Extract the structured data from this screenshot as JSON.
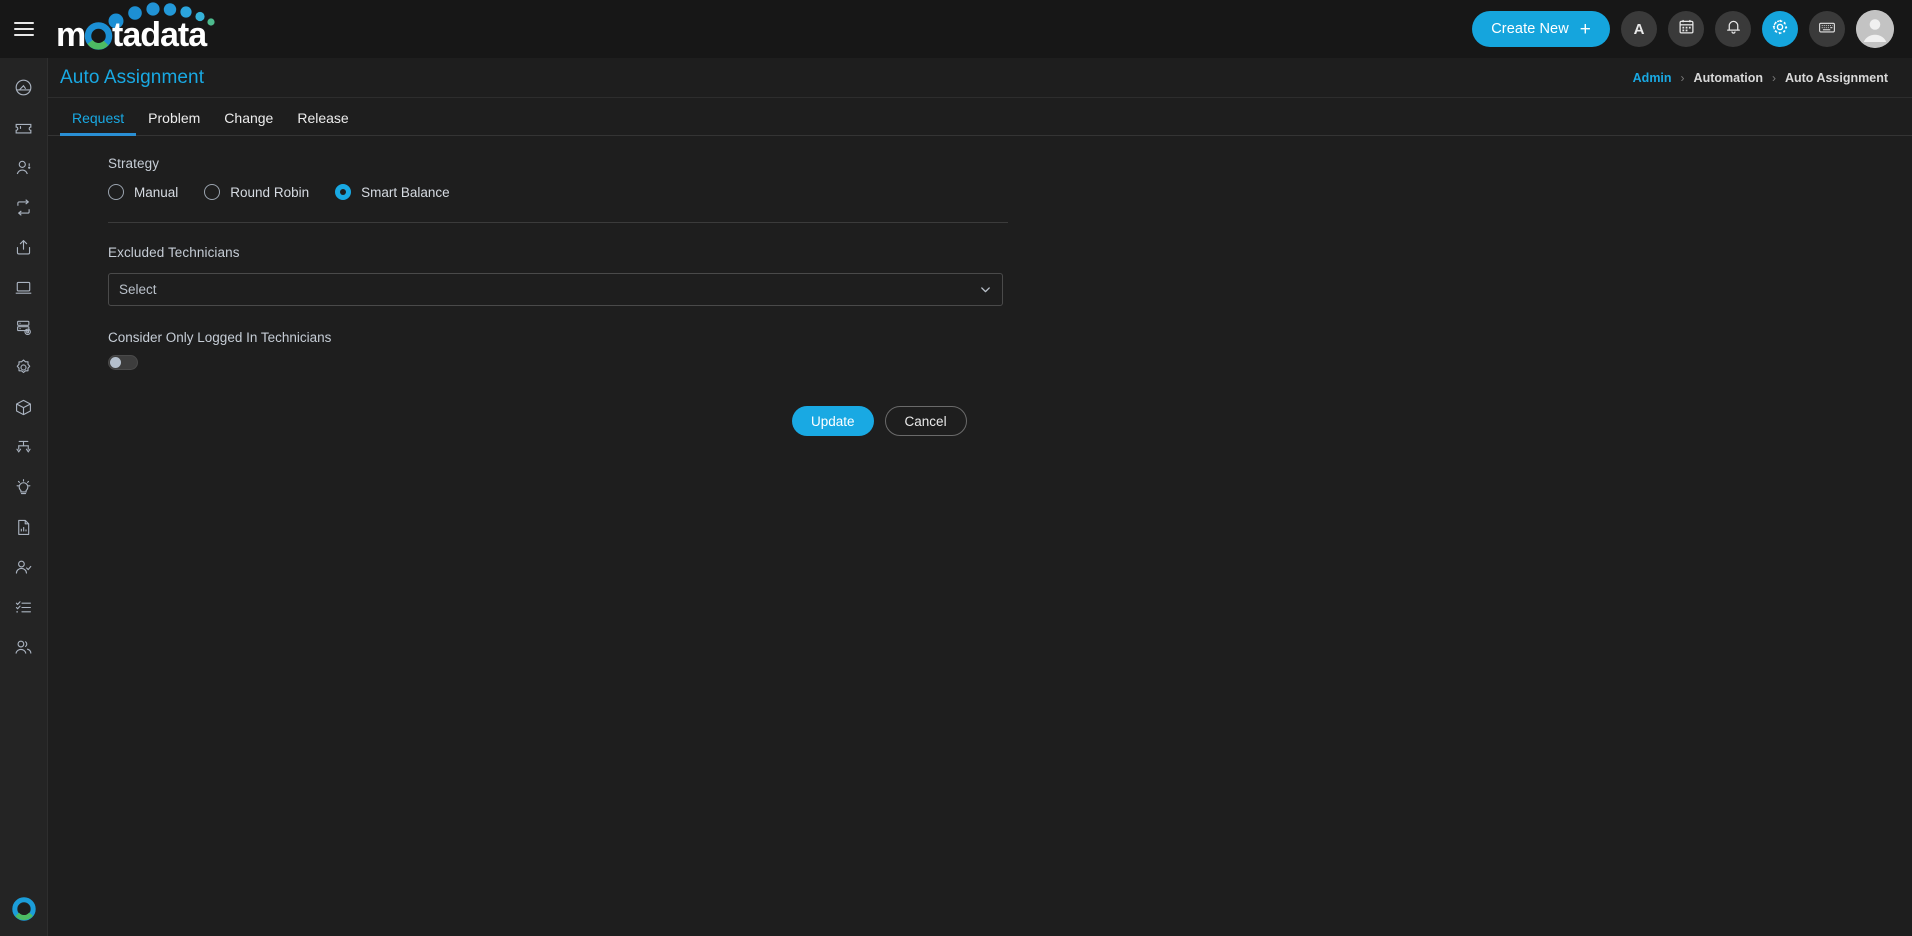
{
  "app": {
    "brand_name": "motadata",
    "brand_colors": {
      "blue": "#1b9dd9",
      "dark_blue": "#1575b8",
      "green": "#5cb85c",
      "accent": "#19a9e3"
    }
  },
  "topbar": {
    "menu_icon": "hamburger-icon",
    "create_new_label": "Create New",
    "create_new_plus": "+",
    "actions": [
      {
        "name": "announcement-button",
        "icon": "letter-a-icon",
        "label": "A"
      },
      {
        "name": "calendar-button",
        "icon": "calendar-icon",
        "label": ""
      },
      {
        "name": "notifications-button",
        "icon": "bell-icon",
        "label": ""
      },
      {
        "name": "settings-button",
        "icon": "gear-icon",
        "label": "",
        "active": true
      },
      {
        "name": "keyboard-shortcuts-button",
        "icon": "keyboard-icon",
        "label": ""
      }
    ],
    "avatar": {
      "name": "user-avatar",
      "icon": "person-icon"
    }
  },
  "sidebar": {
    "items": [
      {
        "name": "sidebar-item-dashboard",
        "icon": "speedometer-icon"
      },
      {
        "name": "sidebar-item-tickets",
        "icon": "ticket-icon"
      },
      {
        "name": "sidebar-item-requester",
        "icon": "user-icon"
      },
      {
        "name": "sidebar-item-workflow",
        "icon": "loop-arrows-icon"
      },
      {
        "name": "sidebar-item-release",
        "icon": "upload-box-icon"
      },
      {
        "name": "sidebar-item-assets",
        "icon": "monitor-icon"
      },
      {
        "name": "sidebar-item-servers",
        "icon": "server-gear-icon"
      },
      {
        "name": "sidebar-item-integrations",
        "icon": "cog-burst-icon"
      },
      {
        "name": "sidebar-item-cmdb",
        "icon": "cube-icon"
      },
      {
        "name": "sidebar-item-hierarchy",
        "icon": "org-chart-icon"
      },
      {
        "name": "sidebar-item-knowledge",
        "icon": "lightbulb-icon"
      },
      {
        "name": "sidebar-item-reports",
        "icon": "report-document-icon"
      },
      {
        "name": "sidebar-item-approvals",
        "icon": "user-check-icon"
      },
      {
        "name": "sidebar-item-tasks",
        "icon": "checklist-icon"
      },
      {
        "name": "sidebar-item-users",
        "icon": "people-icon"
      }
    ],
    "footer_logo": {
      "name": "motadata-mark-icon"
    }
  },
  "page": {
    "title": "Auto Assignment",
    "breadcrumb": [
      {
        "label": "Admin",
        "link": true
      },
      {
        "label": "Automation",
        "link": false
      },
      {
        "label": "Auto Assignment",
        "link": false
      }
    ],
    "breadcrumb_separator": "›"
  },
  "tabs": [
    {
      "label": "Request",
      "active": true
    },
    {
      "label": "Problem",
      "active": false
    },
    {
      "label": "Change",
      "active": false
    },
    {
      "label": "Release",
      "active": false
    }
  ],
  "form": {
    "strategy_label": "Strategy",
    "strategy_options": [
      {
        "label": "Manual",
        "selected": false
      },
      {
        "label": "Round Robin",
        "selected": false
      },
      {
        "label": "Smart Balance",
        "selected": true
      }
    ],
    "excluded_technicians_label": "Excluded Technicians",
    "excluded_technicians_value": "Select",
    "excluded_technicians_placeholder": "Select",
    "logged_in_label": "Consider Only Logged In Technicians",
    "logged_in_enabled": false,
    "update_label": "Update",
    "cancel_label": "Cancel"
  }
}
